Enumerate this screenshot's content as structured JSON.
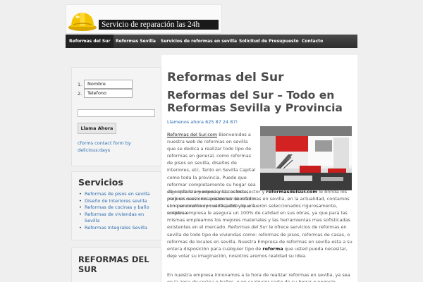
{
  "header": {
    "banner_text": "Servicio de reparación las 24h",
    "helmet_icon": "hard-hat-icon"
  },
  "nav": {
    "items": [
      {
        "label": "Reformas del Sur"
      },
      {
        "label": "Reformas Sevilla"
      },
      {
        "label": "Servicios de reformas en sevilla"
      },
      {
        "label": "Solicitud de Presupuesto"
      },
      {
        "label": "Contacto"
      }
    ]
  },
  "sidebar": {
    "form": {
      "num_1": "1.",
      "num_2": "2.",
      "nombre": "Nombre",
      "telefono": "Telefono",
      "button": "Llama Ahora",
      "credit": "cforms contact form by delicious:days"
    },
    "servicios": {
      "title": "Servicios",
      "items": [
        "Reformas de pisos en sevilla",
        "Diseño de Interiores sevilla",
        "Reformas de cocinas y baño",
        "Reformas de viviendas en Sevilla",
        "Reformas Integrales Sevilla"
      ]
    },
    "reformas_title": "REFORMAS DEL SUR"
  },
  "main": {
    "title": "Reformas del Sur",
    "subtitle": "Reformas del Sur – Todo en Reformas Sevilla y Provincia",
    "call": "Llamenos ahora 625 87 24 87!",
    "p1_link": "Reformas del Sur.com",
    "p1_text": " Bienvenidos a nuestra web de reformas en sevilla que se dedica a realizar todo tipo de reformas en general, como reformas de pisos en sevilla, diseños de interiores, etc, Tanto en Sevilla Capital como toda la provincia. Puede que reformar completamente su hogar sea algo que le emociona y le conforta, pero en ocasiones puede ser aterrador si no se cuenta con el respaldo de una empresa",
    "p2_a": "de confianza y experiencia es ese sector y ",
    "p2_b": "reformasdelsur.com",
    "p2_c": " le brinda los mejores servicios existentes de reformas en sevilla, en la actualidad, contamos con personal muy cualificados y que fueron seleccionados rigurosamente, nuestra empresa le asegura un 100% de calidad en sus obras, ya que para las mismas empleamos los mejores materiales  y las herramientas mas sofisticadas existentes en el mercado. ",
    "p2_d": "Reformas del Sur",
    " p2_e": "",
    "p2_e": " le ofrece servicios de reformas en sevilla de todo tipo de viviendas como: reformas de pisos, reformas de casas, o reformas de locales en sevilla. Nuestra Empresa de reformas en sevilla esta a su entera disposición para cualquier tipo de ",
    "p2_f": "reforma",
    "p2_g": " que usted pueda necesitar, deje volar su imaginación, nosotros aremos realidad su idea.",
    "p3": "En nuestra empresa innovamos a la hora de realizar reformas en sevilla, ya sea en la zona de cocina o baños, o en cualquier parte de su hogar o negocio. Nuestro principal"
  }
}
